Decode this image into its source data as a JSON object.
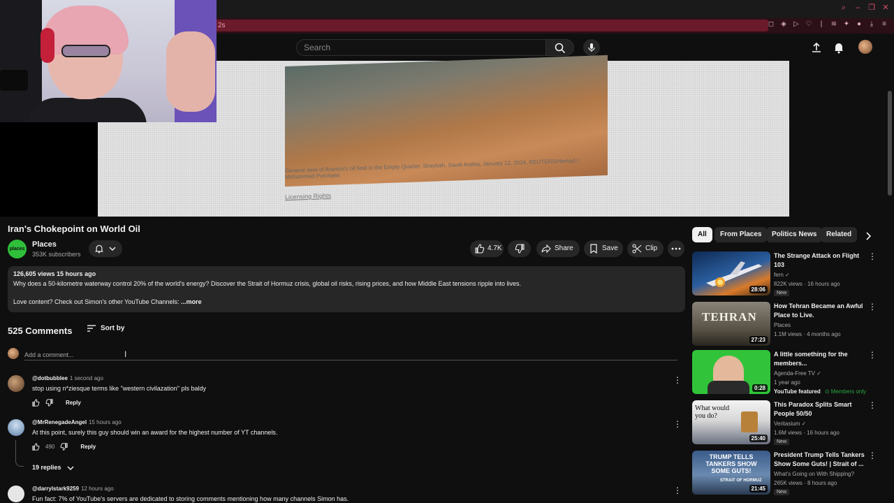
{
  "browser": {
    "url_fragment": "2s"
  },
  "header": {
    "search_placeholder": "Search"
  },
  "video": {
    "caption": "General view of Aramco's oil field in the Empty Quarter, Shaybah, Saudi Arabia, January 12, 2024. REUTERS/Hamad I Mohammed Purchase",
    "caption_link": "Licensing Rights",
    "title": "Iran's Chokepoint on World Oil"
  },
  "channel": {
    "name": "Places",
    "subscribers": "353K subscribers",
    "avatar_text": "places"
  },
  "actions": {
    "likes": "4.7K",
    "share": "Share",
    "save": "Save",
    "clip": "Clip"
  },
  "description": {
    "meta": "126,605 views  15 hours ago",
    "text": "Why does a 50-kilometre waterway control 20% of the world's energy? Discover the Strait of Hormuz crisis, global oil risks, rising prices, and how Middle East tensions ripple into lives.",
    "line2": "Love content? Check out Simon's other YouTube Channels:",
    "more": "...more"
  },
  "comments": {
    "count": "525 Comments",
    "sort_label": "Sort by",
    "add_placeholder": "Add a comment...",
    "items": [
      {
        "author": "@dotbubblee",
        "time": "1 second ago",
        "text": "stop using n*ziesque terms like \"western civilazation\" pls baldy",
        "likes": "",
        "reply": "Reply",
        "avatar_color": "#8a6a4a"
      },
      {
        "author": "@MrRenegadeAngel",
        "time": "15 hours ago",
        "text": "At this point, surely this guy should win an award for the highest number of YT channels.",
        "likes": "490",
        "reply": "Reply",
        "avatar_color": "#5b7fa8"
      },
      {
        "author": "@darrylstark9259",
        "time": "12 hours ago",
        "text": "Fun fact: 7% of YouTube's servers are dedicated to storing comments mentioning how many channels Simon has.",
        "likes": "",
        "reply": "",
        "avatar_color": "#d8d8d8"
      }
    ],
    "replies": "19 replies"
  },
  "chips": [
    "All",
    "From Places",
    "Politics News",
    "Related"
  ],
  "recommendations": [
    {
      "title": "The Strange Attack on Flight 103",
      "channel": "fern",
      "meta": "822K views · 16 hours ago",
      "badge": "New",
      "duration": "28:06",
      "verified": true
    },
    {
      "title": "How Tehran Became an Awful Place to Live.",
      "channel": "Places",
      "meta": "1.1M views · 4 months ago",
      "badge": "",
      "duration": "27:23",
      "thumb_text": "TEHRAN",
      "verified": false
    },
    {
      "title": "A little something for the members...",
      "channel": "Agenda-Free TV",
      "meta": "1 year ago",
      "featured": "YouTube featured",
      "members": "Members only",
      "duration": "0:28",
      "verified": true
    },
    {
      "title": "This Paradox Splits Smart People 50/50",
      "channel": "Veritasium",
      "meta": "1.6M views · 16 hours ago",
      "badge": "New",
      "duration": "25:40",
      "thumb_text": "What would you do?",
      "verified": true
    },
    {
      "title": "President Trump Tells Tankers Show Some Guts! | Strait of ...",
      "channel": "What's Going on With Shipping?",
      "meta": "265K views · 8 hours ago",
      "badge": "New",
      "duration": "21:45",
      "thumb_text": "TRUMP TELLS TANKERS SHOW SOME GUTS!",
      "thumb_text2": "STRAIT OF HORMUZ",
      "verified": false
    }
  ]
}
